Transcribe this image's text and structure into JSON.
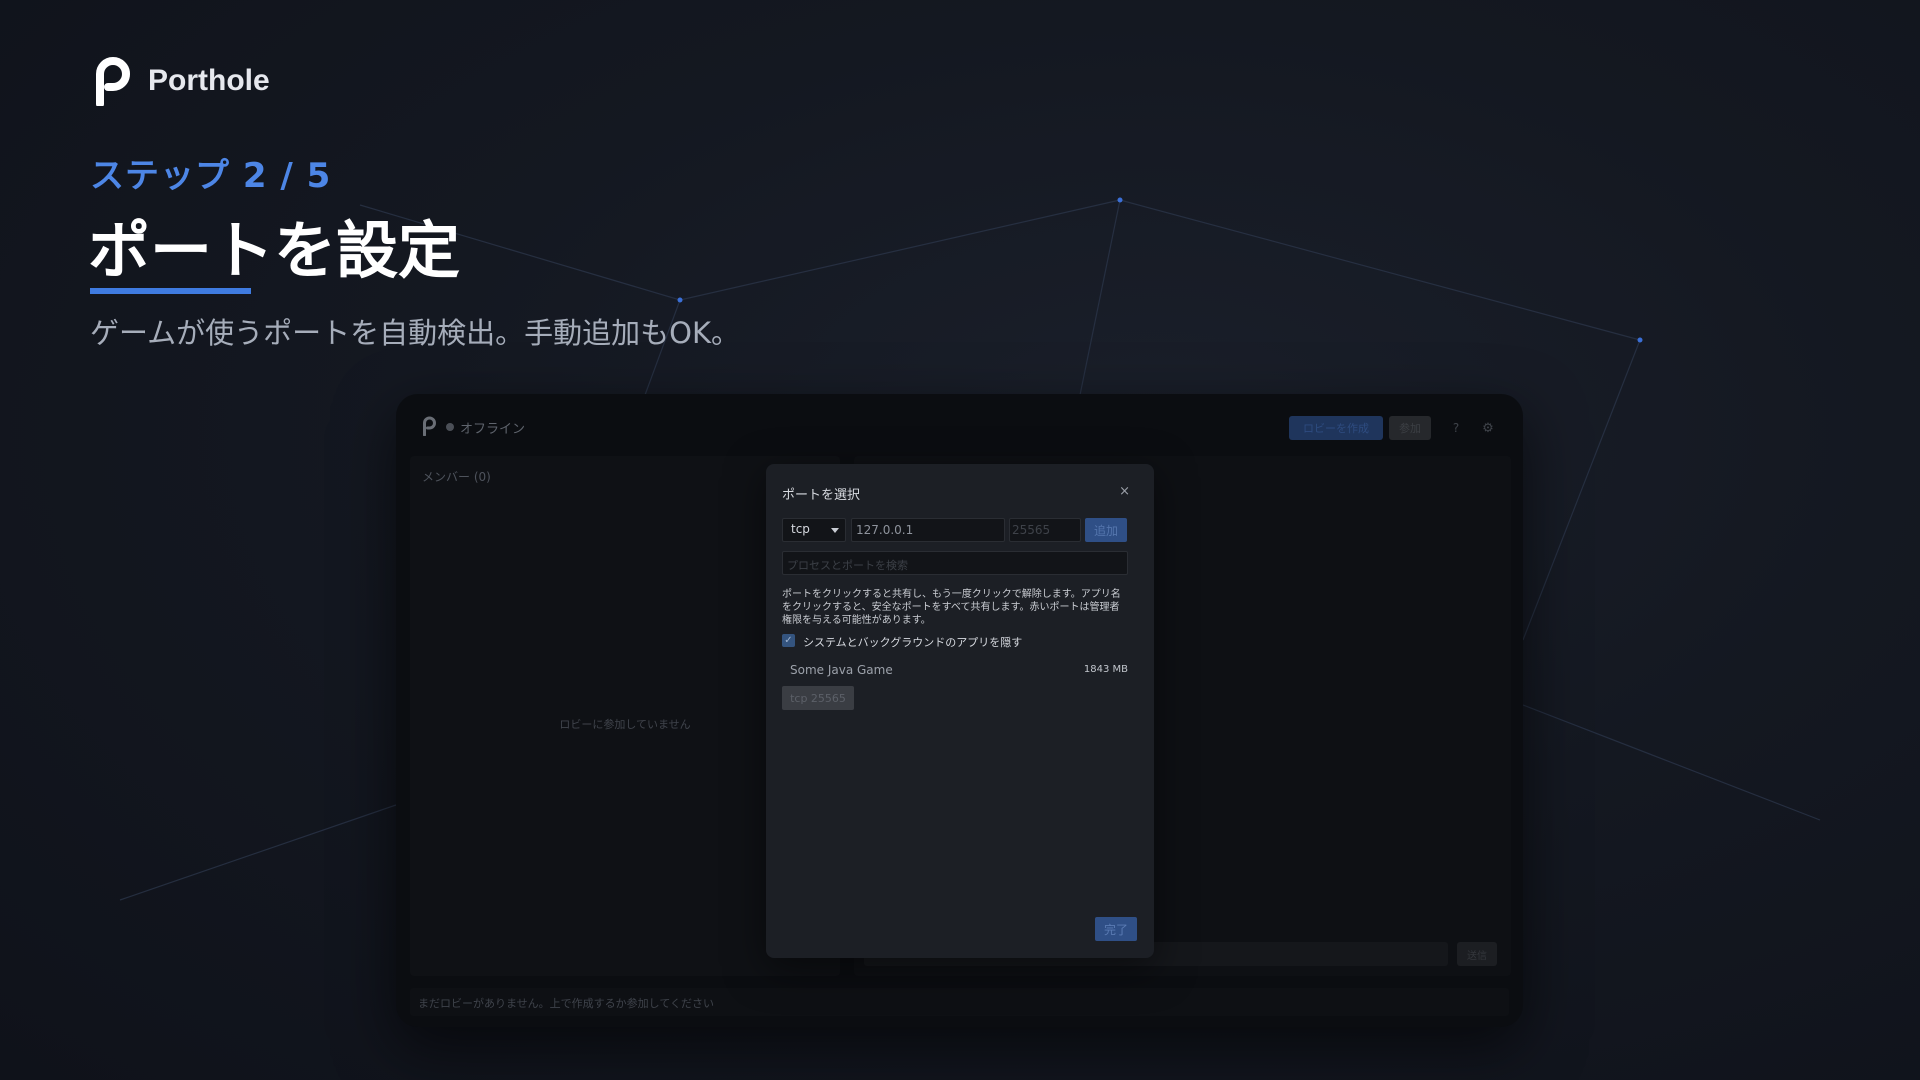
{
  "brand": {
    "name": "Porthole"
  },
  "step": {
    "label": "ステップ 2 / 5"
  },
  "hero": {
    "title": "ポートを設定",
    "subtitle": "ゲームが使うポートを自動検出。手動追加もOK。"
  },
  "colors": {
    "accent": "#3f7be0",
    "background": "#141821",
    "modal": "#1c1f25"
  },
  "app": {
    "status": "オフライン",
    "header": {
      "create_lobby": "ロビーを作成",
      "join": "参加",
      "help": "?",
      "settings_icon": "gear-icon"
    },
    "members_title": "メンバー (0)",
    "not_in_lobby": "ロビーに参加していません",
    "chat_send": "送信",
    "footer": "まだロビーがありません。上で作成するか参加してください"
  },
  "modal": {
    "title": "ポートを選択",
    "close": "×",
    "protocol": "tcp",
    "ip_value": "127.0.0.1",
    "port_placeholder": "25565",
    "add_label": "追加",
    "search_placeholder": "プロセスとポートを検索",
    "help_text": "ポートをクリックすると共有し、もう一度クリックで解除します。アプリ名をクリックすると、安全なポートをすべて共有します。赤いポートは管理者権限を与える可能性があります。",
    "hide_system_label": "システムとバックグラウンドのアプリを隠す",
    "hide_system_checked": true,
    "apps": [
      {
        "name": "Some Java Game",
        "memory": "1843 MB",
        "ports": [
          "tcp 25565"
        ]
      }
    ],
    "done_label": "完了"
  }
}
